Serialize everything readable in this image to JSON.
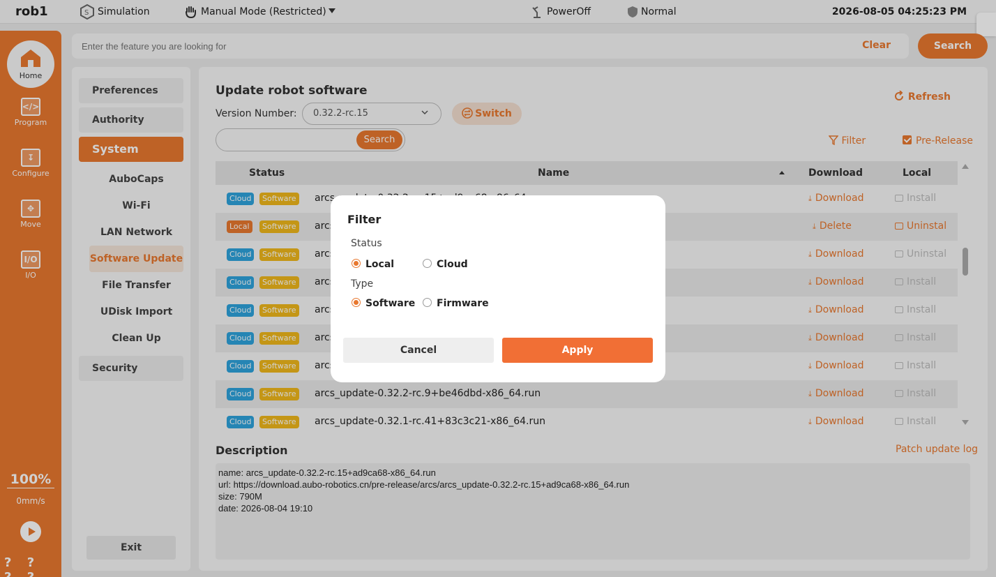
{
  "topbar": {
    "robot_name": "rob1",
    "simulation": "Simulation",
    "mode": "Manual Mode (Restricted)",
    "power": "PowerOff",
    "safety": "Normal",
    "datetime": "2026-08-05 04:25:23 PM"
  },
  "nav": {
    "home": "Home",
    "program": "Program",
    "configure": "Configure",
    "move": "Move",
    "io": "I/O",
    "io_icon_text": "I/O",
    "speed_percent": "100%",
    "speed_value": "0mm/s",
    "help": "? ? ? ?"
  },
  "search": {
    "placeholder": "Enter the feature you are looking for",
    "clear": "Clear",
    "button": "Search"
  },
  "menu": {
    "preferences": "Preferences",
    "authority": "Authority",
    "system": "System",
    "sub": [
      "AuboCaps",
      "Wi-Fi",
      "LAN Network Port",
      "Software Update",
      "File Transfer",
      "UDisk Import",
      "Clean Up"
    ],
    "security": "Security",
    "exit": "Exit"
  },
  "update": {
    "title": "Update robot software",
    "refresh": "Refresh",
    "version_label": "Version Number:",
    "version_value": "0.32.2-rc.15",
    "switch": "Switch",
    "search_button": "Search",
    "filter": "Filter",
    "prerelease": "Pre-Release",
    "columns": {
      "status": "Status",
      "name": "Name",
      "download": "Download",
      "local": "Local"
    },
    "rows": [
      {
        "status": "Cloud",
        "type": "Software",
        "name": "arcs_update-0.32.2-rc.15+ad9ca68-x86_64.run",
        "download": "Download",
        "local": "Install"
      },
      {
        "status": "Local",
        "type": "Software",
        "name": "arcs_update-0.32.2-rc.15+ad9ca68-x86_64.run",
        "download": "Delete",
        "local": "Uninstal"
      },
      {
        "status": "Cloud",
        "type": "Software",
        "name": "arcs_update-0.32.2-rc.14+ad9ca68-x86_64.run",
        "download": "Download",
        "local": "Uninstal"
      },
      {
        "status": "Cloud",
        "type": "Software",
        "name": "arcs_update-0.32.2-rc.13+ad9ca68-x86_64.run",
        "download": "Download",
        "local": "Install"
      },
      {
        "status": "Cloud",
        "type": "Software",
        "name": "arcs_update-0.32.2-rc.12+ad9ca68-x86_64.run",
        "download": "Download",
        "local": "Install"
      },
      {
        "status": "Cloud",
        "type": "Software",
        "name": "arcs_update-0.32.2-rc.11+ad9ca68-x86_64.run",
        "download": "Download",
        "local": "Install"
      },
      {
        "status": "Cloud",
        "type": "Software",
        "name": "arcs_update-0.32.2-rc.10+ad9ca68-x86_64.run",
        "download": "Download",
        "local": "Install"
      },
      {
        "status": "Cloud",
        "type": "Software",
        "name": "arcs_update-0.32.2-rc.9+be46dbd-x86_64.run",
        "download": "Download",
        "local": "Install"
      },
      {
        "status": "Cloud",
        "type": "Software",
        "name": "arcs_update-0.32.1-rc.41+83c3c21-x86_64.run",
        "download": "Download",
        "local": "Install"
      }
    ],
    "description_title": "Description",
    "patch_log": "Patch update log",
    "description": {
      "name": "name: arcs_update-0.32.2-rc.15+ad9ca68-x86_64.run",
      "url": "url: https://download.aubo-robotics.cn/pre-release/arcs/arcs_update-0.32.2-rc.15+ad9ca68-x86_64.run",
      "size": "size: 790M",
      "date": "date: 2026-08-04 19:10"
    }
  },
  "filter_dialog": {
    "title": "Filter",
    "status_label": "Status",
    "status_local": "Local",
    "status_cloud": "Cloud",
    "type_label": "Type",
    "type_software": "Software",
    "type_firmware": "Firmware",
    "cancel": "Cancel",
    "apply": "Apply"
  },
  "colors": {
    "accent": "#e8782f",
    "cloud": "#2ea3dc",
    "software": "#f0b81b"
  }
}
